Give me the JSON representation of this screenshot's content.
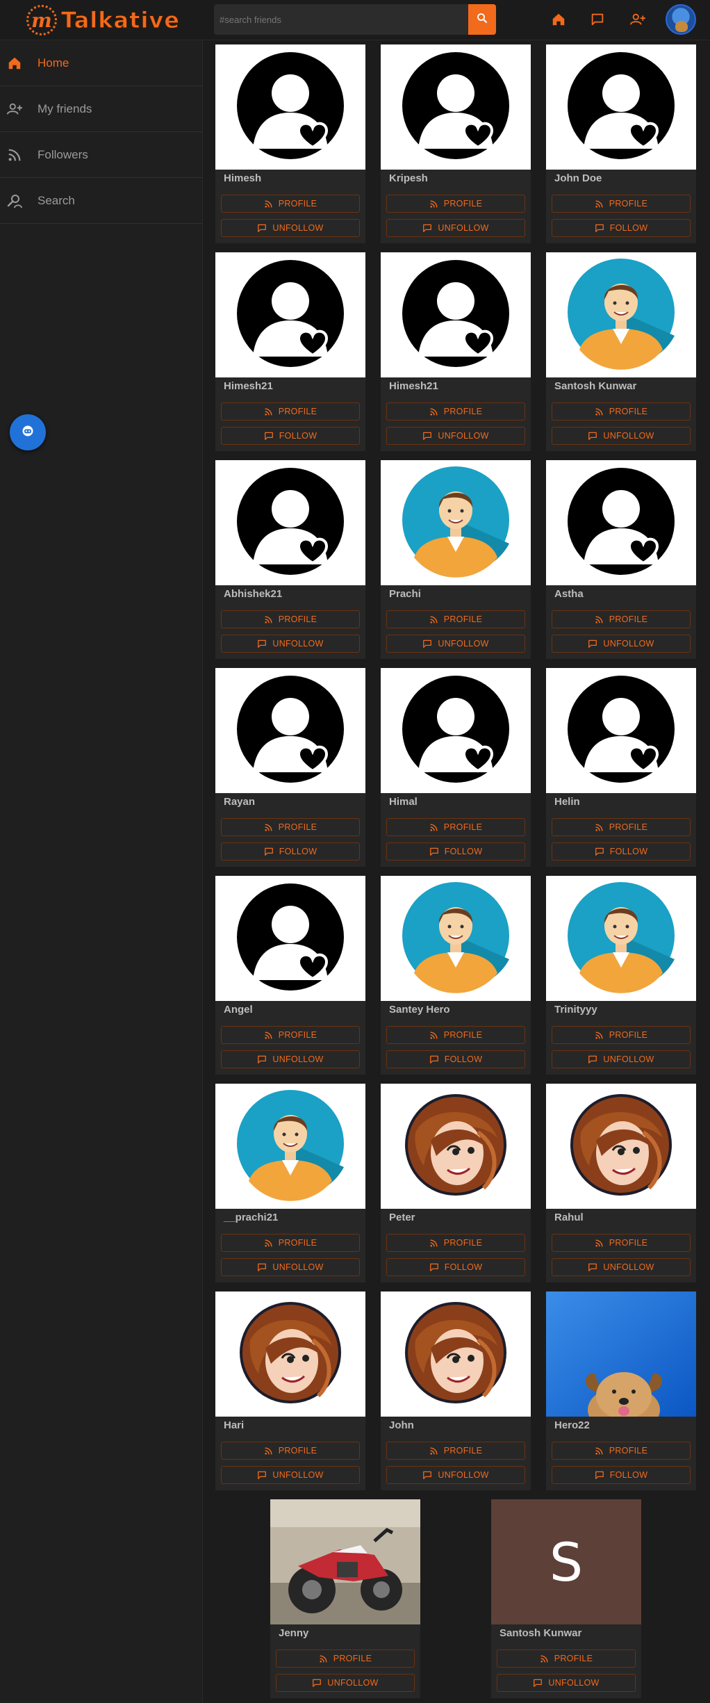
{
  "app": {
    "logo_letter": "m",
    "title": "Talkative"
  },
  "search": {
    "placeholder": "#search friends"
  },
  "header_icons": [
    "home-icon",
    "chat-icon",
    "add-friend-icon"
  ],
  "sidebar": {
    "items": [
      {
        "label": "Home",
        "icon": "home-icon",
        "active": true
      },
      {
        "label": "My friends",
        "icon": "add-friend-icon",
        "active": false
      },
      {
        "label": "Followers",
        "icon": "rss-icon",
        "active": false
      },
      {
        "label": "Search",
        "icon": "person-search-icon",
        "active": false
      }
    ]
  },
  "colors": {
    "accent": "#f26a1b",
    "background": "#1c1c1c",
    "card": "#272727",
    "fab": "#2172d8"
  },
  "button_labels": {
    "profile": "PROFILE",
    "follow": "FOLLOW",
    "unfollow": "UNFOLLOW"
  },
  "users": [
    {
      "name": "Himesh",
      "avatar": "default-silhouette",
      "action": "UNFOLLOW"
    },
    {
      "name": "Kripesh",
      "avatar": "default-silhouette",
      "action": "UNFOLLOW"
    },
    {
      "name": "John Doe",
      "avatar": "default-silhouette",
      "action": "FOLLOW"
    },
    {
      "name": "Himesh21",
      "avatar": "default-silhouette",
      "action": "FOLLOW"
    },
    {
      "name": "Himesh21",
      "avatar": "default-silhouette",
      "action": "UNFOLLOW"
    },
    {
      "name": "Santosh Kunwar",
      "avatar": "cartoon-man",
      "action": "UNFOLLOW"
    },
    {
      "name": "Abhishek21",
      "avatar": "default-silhouette",
      "action": "UNFOLLOW"
    },
    {
      "name": "Prachi",
      "avatar": "cartoon-man",
      "action": "UNFOLLOW"
    },
    {
      "name": "Astha",
      "avatar": "default-silhouette",
      "action": "UNFOLLOW"
    },
    {
      "name": "Rayan",
      "avatar": "default-silhouette",
      "action": "FOLLOW"
    },
    {
      "name": "Himal",
      "avatar": "default-silhouette",
      "action": "FOLLOW"
    },
    {
      "name": "Helin",
      "avatar": "default-silhouette",
      "action": "FOLLOW"
    },
    {
      "name": "Angel",
      "avatar": "default-silhouette",
      "action": "UNFOLLOW"
    },
    {
      "name": "Santey Hero",
      "avatar": "cartoon-man",
      "action": "FOLLOW"
    },
    {
      "name": "Trinityyy",
      "avatar": "cartoon-man",
      "action": "UNFOLLOW"
    },
    {
      "name": "__prachi21",
      "avatar": "cartoon-man",
      "action": "UNFOLLOW"
    },
    {
      "name": "Peter",
      "avatar": "cartoon-girl",
      "action": "FOLLOW"
    },
    {
      "name": "Rahul",
      "avatar": "cartoon-girl",
      "action": "UNFOLLOW"
    },
    {
      "name": "Hari",
      "avatar": "cartoon-girl",
      "action": "UNFOLLOW"
    },
    {
      "name": "John",
      "avatar": "cartoon-girl",
      "action": "UNFOLLOW"
    },
    {
      "name": "Hero22",
      "avatar": "puppy-photo",
      "action": "FOLLOW"
    },
    {
      "name": "Jenny",
      "avatar": "motorbike-photo",
      "action": "UNFOLLOW"
    },
    {
      "name": "Santosh Kunwar",
      "avatar": "letter-avatar",
      "avatar_letter": "S",
      "action": "UNFOLLOW"
    }
  ]
}
